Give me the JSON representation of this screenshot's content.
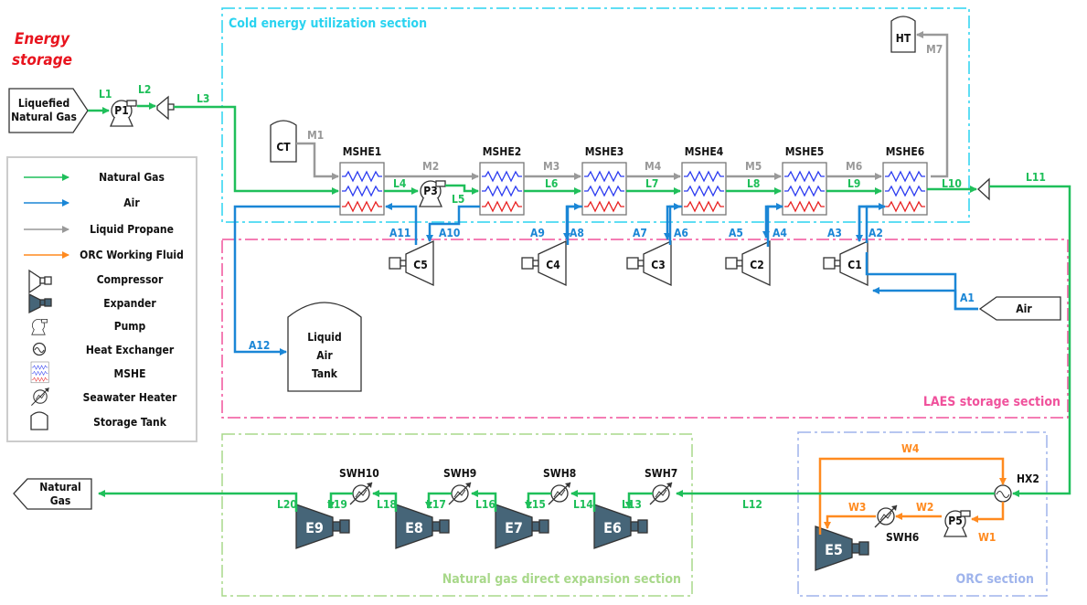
{
  "title_lines": [
    "Energy",
    "storage"
  ],
  "lng_source": [
    "Liquefied",
    "Natural Gas"
  ],
  "ng_sink": [
    "Natural",
    "Gas"
  ],
  "air_source": "Air",
  "sections": {
    "cold": "Cold energy utilization section",
    "laes": "LAES storage section",
    "ngde": "Natural gas direct expansion section",
    "orc": "ORC section"
  },
  "colors": {
    "natural_gas": "#1fbf5a",
    "air": "#1a86d6",
    "propane": "#999999",
    "orc": "#ff8a1f",
    "cold_section": "#2ad3f0",
    "laes_section": "#f0529c",
    "ngde_section": "#a8d88a",
    "orc_section": "#9fb4ec",
    "energy_title": "#e8141e"
  },
  "legend": [
    "Natural Gas",
    "Air",
    "Liquid Propane",
    "ORC Working Fluid",
    "Compressor",
    "Expander",
    "Pump",
    "Heat Exchanger",
    "MSHE",
    "Seawater Heater",
    "Storage Tank"
  ],
  "legend_icons": [
    "green-arrow",
    "blue-arrow",
    "gray-arrow",
    "orange-arrow",
    "compressor-icon",
    "expander-icon",
    "pump-icon",
    "heat-exchanger-icon",
    "mshe-icon",
    "seawater-heater-icon",
    "storage-tank-icon"
  ],
  "equipment": {
    "mshe": [
      "MSHE1",
      "MSHE2",
      "MSHE3",
      "MSHE4",
      "MSHE5",
      "MSHE6"
    ],
    "compressors": [
      "C5",
      "C4",
      "C3",
      "C2",
      "C1"
    ],
    "expanders": [
      "E9",
      "E8",
      "E7",
      "E6",
      "E5"
    ],
    "pumps": [
      "P1",
      "P3",
      "P5"
    ],
    "swh": [
      "SWH10",
      "SWH9",
      "SWH8",
      "SWH7",
      "SWH6"
    ],
    "tanks": {
      "ct": "CT",
      "ht": "HT",
      "lat": [
        "Liquid",
        "Air",
        "Tank"
      ]
    },
    "hx": "HX2"
  },
  "streams": {
    "ng": [
      "L1",
      "L2",
      "L3",
      "L4",
      "L5",
      "L6",
      "L7",
      "L8",
      "L9",
      "L10",
      "L11",
      "L12",
      "L13",
      "L14",
      "L15",
      "L16",
      "L17",
      "L18",
      "L19",
      "L20"
    ],
    "air": [
      "A1",
      "A2",
      "A3",
      "A4",
      "A5",
      "A6",
      "A7",
      "A8",
      "A9",
      "A10",
      "A11",
      "A12"
    ],
    "propane": [
      "M1",
      "M2",
      "M3",
      "M4",
      "M5",
      "M6",
      "M7"
    ],
    "orc": [
      "W1",
      "W2",
      "W3",
      "W4"
    ]
  }
}
